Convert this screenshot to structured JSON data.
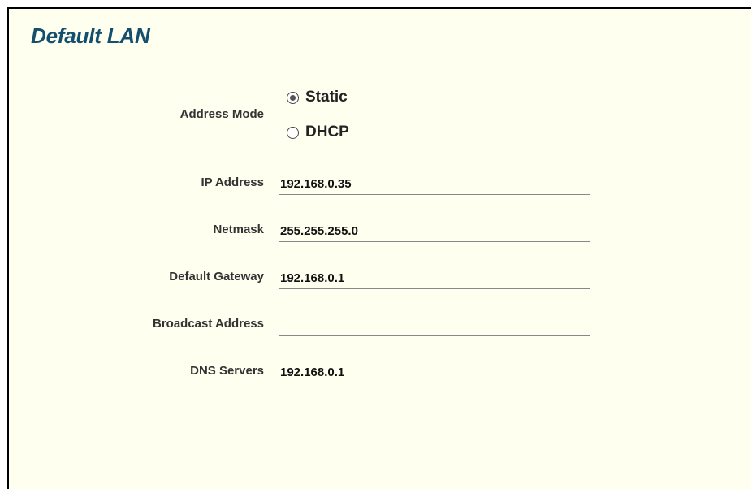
{
  "section": {
    "title": "Default LAN"
  },
  "address_mode": {
    "label": "Address Mode",
    "options": [
      {
        "label": "Static",
        "selected": true
      },
      {
        "label": "DHCP",
        "selected": false
      }
    ]
  },
  "fields": {
    "ip_address": {
      "label": "IP Address",
      "value": "192.168.0.35"
    },
    "netmask": {
      "label": "Netmask",
      "value": "255.255.255.0"
    },
    "default_gateway": {
      "label": "Default Gateway",
      "value": "192.168.0.1"
    },
    "broadcast_address": {
      "label": "Broadcast Address",
      "value": ""
    },
    "dns_servers": {
      "label": "DNS Servers",
      "value": "192.168.0.1"
    }
  },
  "colors": {
    "panel_background": "#fffff0",
    "title": "#14506e",
    "border": "#000000"
  }
}
